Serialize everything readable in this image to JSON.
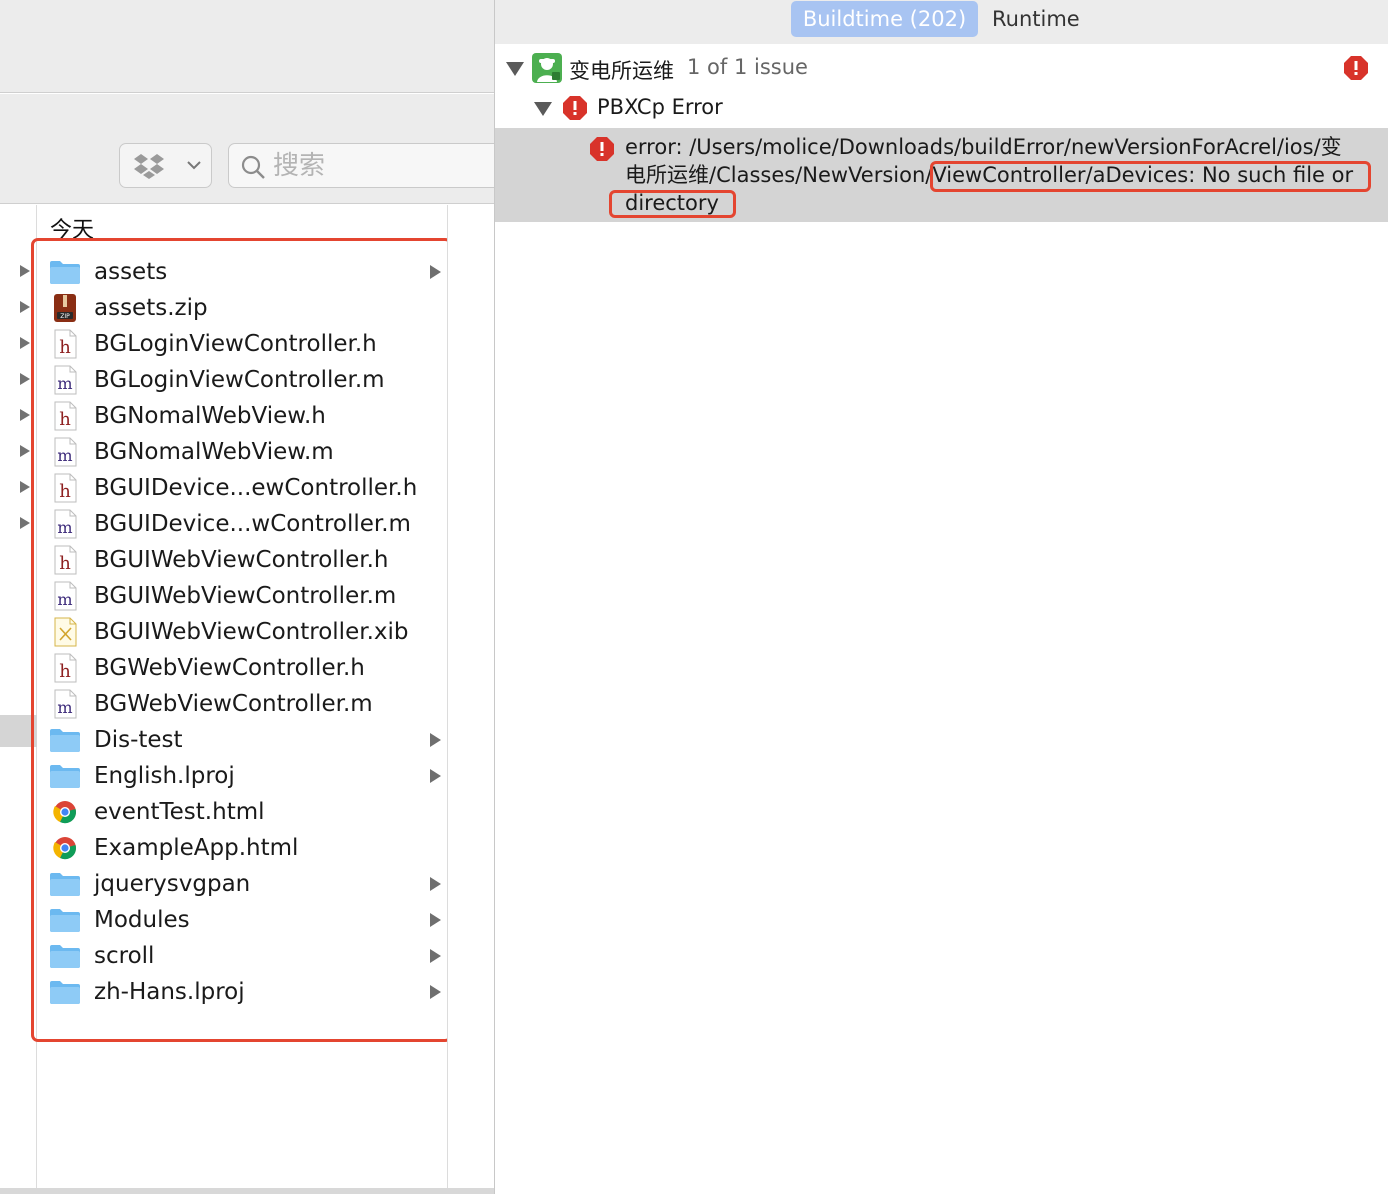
{
  "finder": {
    "search_placeholder": "搜索",
    "column_header": "今天",
    "files": [
      {
        "name": "assets",
        "kind": "folder",
        "has_children": true
      },
      {
        "name": "assets.zip",
        "kind": "zip",
        "has_children": false
      },
      {
        "name": "BGLoginViewController.h",
        "kind": "h",
        "has_children": false
      },
      {
        "name": "BGLoginViewController.m",
        "kind": "m",
        "has_children": false
      },
      {
        "name": "BGNomalWebView.h",
        "kind": "h",
        "has_children": false
      },
      {
        "name": "BGNomalWebView.m",
        "kind": "m",
        "has_children": false
      },
      {
        "name": "BGUIDevice...ewController.h",
        "kind": "h",
        "has_children": false
      },
      {
        "name": "BGUIDevice...wController.m",
        "kind": "m",
        "has_children": false
      },
      {
        "name": "BGUIWebViewController.h",
        "kind": "h",
        "has_children": false
      },
      {
        "name": "BGUIWebViewController.m",
        "kind": "m",
        "has_children": false
      },
      {
        "name": "BGUIWebViewController.xib",
        "kind": "xib",
        "has_children": false
      },
      {
        "name": "BGWebViewController.h",
        "kind": "h",
        "has_children": false
      },
      {
        "name": "BGWebViewController.m",
        "kind": "m",
        "has_children": false
      },
      {
        "name": "Dis-test",
        "kind": "folder",
        "has_children": true
      },
      {
        "name": "English.lproj",
        "kind": "folder",
        "has_children": true
      },
      {
        "name": "eventTest.html",
        "kind": "html",
        "has_children": false
      },
      {
        "name": "ExampleApp.html",
        "kind": "html",
        "has_children": false
      },
      {
        "name": "jquerysvgpan",
        "kind": "folder",
        "has_children": true
      },
      {
        "name": "Modules",
        "kind": "folder",
        "has_children": true
      },
      {
        "name": "scroll",
        "kind": "folder",
        "has_children": true
      },
      {
        "name": "zh-Hans.lproj",
        "kind": "folder",
        "has_children": true
      }
    ]
  },
  "issues": {
    "tabs": {
      "buildtime": "Buildtime (202)",
      "runtime": "Runtime"
    },
    "project": {
      "name": "变电所运维",
      "count": "1 of 1 issue"
    },
    "error_type": "PBXCp Error",
    "error_detail": {
      "line1": "error: /Users/molice/Downloads/buildError/newVersionForAcrel/ios/变",
      "line2_a": "电所运维/Classes/NewVersion",
      "line2_b": "/ViewController/aDevices: No such file or",
      "line3": "directory"
    }
  },
  "colors": {
    "highlight": "#e44530",
    "error_red": "#d8332a",
    "tab_selected": "#a8c4f2",
    "folder_blue": "#6cb9f0"
  }
}
